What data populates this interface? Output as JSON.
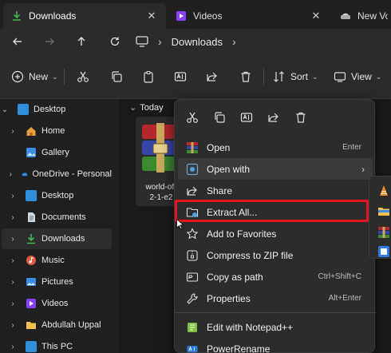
{
  "tabs": [
    {
      "label": "Downloads",
      "active": true
    },
    {
      "label": "Videos",
      "active": false
    },
    {
      "label": "New Volume",
      "active": false
    }
  ],
  "address": {
    "breadcrumb": "Downloads"
  },
  "commandbar": {
    "new_label": "New",
    "sort_label": "Sort",
    "view_label": "View"
  },
  "sidebar": {
    "items": [
      {
        "label": "Desktop",
        "expanded": true
      },
      {
        "label": "Home"
      },
      {
        "label": "Gallery"
      },
      {
        "label": "OneDrive - Personal"
      },
      {
        "label": "Desktop"
      },
      {
        "label": "Documents"
      },
      {
        "label": "Downloads",
        "selected": true
      },
      {
        "label": "Music"
      },
      {
        "label": "Pictures"
      },
      {
        "label": "Videos"
      },
      {
        "label": "Abdullah Uppal"
      },
      {
        "label": "This PC"
      }
    ]
  },
  "content": {
    "group_header": "Today",
    "file_name_line1": "world-of-",
    "file_name_line2": "2-1-e2"
  },
  "context_menu": {
    "items": [
      {
        "label": "Open",
        "shortcut": "Enter"
      },
      {
        "label": "Open with",
        "has_submenu": true
      },
      {
        "label": "Share"
      },
      {
        "label": "Extract All..."
      },
      {
        "label": "Add to Favorites"
      },
      {
        "label": "Compress to ZIP file"
      },
      {
        "label": "Copy as path",
        "shortcut": "Ctrl+Shift+C"
      },
      {
        "label": "Properties",
        "shortcut": "Alt+Enter"
      },
      {
        "label": "Edit with Notepad++"
      },
      {
        "label": "PowerRename"
      }
    ]
  },
  "colors": {
    "highlight": "#e3141b",
    "accent": "#4aa3e8"
  }
}
